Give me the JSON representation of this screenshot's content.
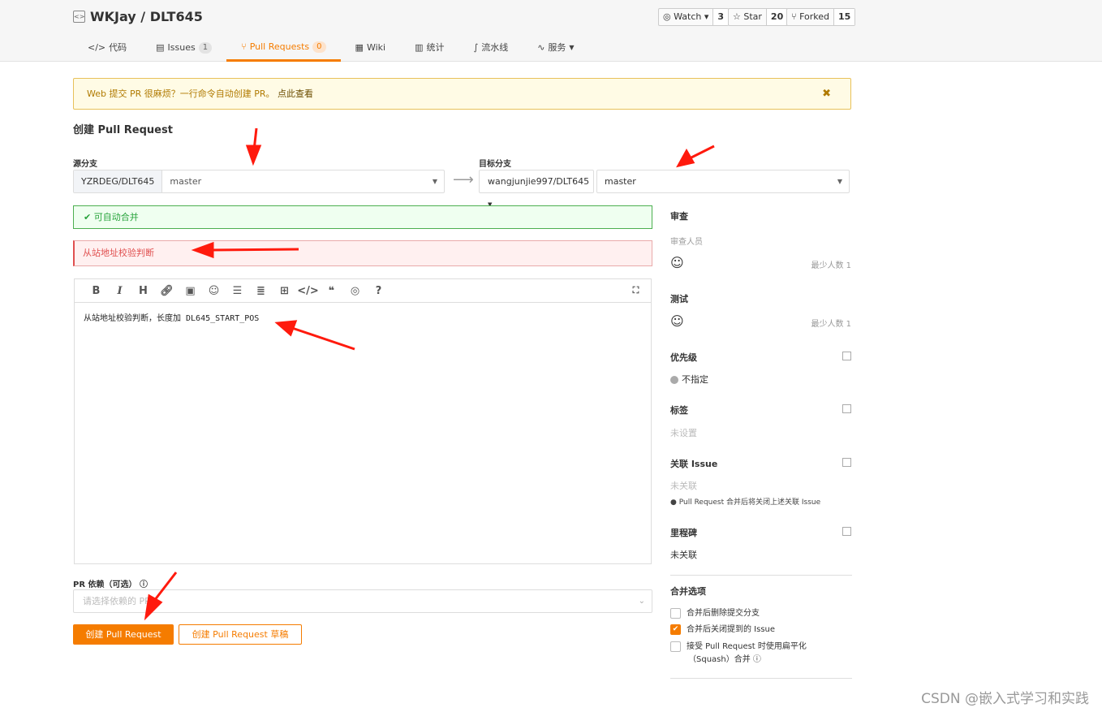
{
  "repo": {
    "title": "WKJay / DLT645",
    "watch": "Watch",
    "watch_count": "3",
    "star": "Star",
    "star_count": "20",
    "forked": "Forked",
    "forked_count": "15"
  },
  "tabs": [
    {
      "label": "代码"
    },
    {
      "label": "Issues",
      "badge": "1"
    },
    {
      "label": "Pull Requests",
      "badge": "0"
    },
    {
      "label": "Wiki"
    },
    {
      "label": "统计"
    },
    {
      "label": "流水线"
    },
    {
      "label": "服务"
    }
  ],
  "notice": {
    "text": "Web 提交 PR 很麻烦？一行命令自动创建 PR。",
    "link": "点此查看"
  },
  "page_title": "创建 Pull Request",
  "source": {
    "label": "源分支",
    "repo": "YZRDEG/DLT645",
    "branch": "master"
  },
  "target": {
    "label": "目标分支",
    "repo": "wangjunjie997/DLT645",
    "branch": "master"
  },
  "merge_status": "可自动合并",
  "pr_title": "从站地址校验判断",
  "body": "从站地址校验判断，长度加 DL645_START_POS",
  "toolbar_icons": [
    "bold",
    "italic",
    "heading",
    "link",
    "image",
    "emoji",
    "bullet-list",
    "ordered-list",
    "table",
    "code",
    "quote",
    "preview",
    "help"
  ],
  "dependency": {
    "label": "PR 依赖（可选）",
    "placeholder": "请选择依赖的 PR"
  },
  "buttons": {
    "create": "创建 Pull Request",
    "draft": "创建 Pull Request 草稿"
  },
  "sidebar": {
    "review": {
      "title": "审查",
      "sub": "审查人员",
      "min": "最少人数 1"
    },
    "test": {
      "title": "测试",
      "min": "最少人数 1"
    },
    "priority": {
      "title": "优先级",
      "value": "不指定"
    },
    "labels": {
      "title": "标签",
      "value": "未设置"
    },
    "issue": {
      "title": "关联 Issue",
      "value": "未关联",
      "note": "Pull Request 合并后将关闭上述关联 Issue"
    },
    "milestone": {
      "title": "里程碑",
      "value": "未关联"
    },
    "merge": {
      "title": "合并选项",
      "options": [
        {
          "label": "合并后删除提交分支",
          "checked": false
        },
        {
          "label": "合并后关闭提到的 Issue",
          "checked": true
        },
        {
          "label": "接受 Pull Request 时使用扁平化",
          "label2": "（Squash）合并",
          "checked": false
        }
      ]
    }
  },
  "watermark": "CSDN @嵌入式学习和实践",
  "colors": {
    "accent": "#f57c00",
    "success": "#4caf50",
    "error": "#e05050",
    "annotation": "#ff1a0d"
  }
}
